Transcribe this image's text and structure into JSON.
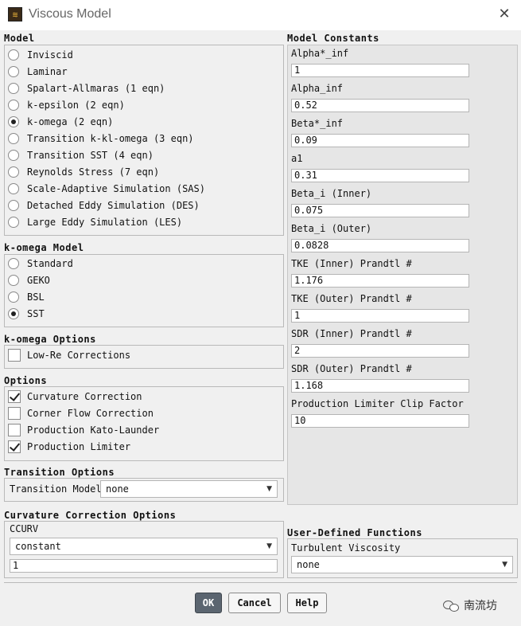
{
  "window": {
    "title": "Viscous Model"
  },
  "model": {
    "title": "Model",
    "options": [
      {
        "label": "Inviscid",
        "selected": false
      },
      {
        "label": "Laminar",
        "selected": false
      },
      {
        "label": "Spalart-Allmaras (1 eqn)",
        "selected": false
      },
      {
        "label": "k-epsilon (2 eqn)",
        "selected": false
      },
      {
        "label": "k-omega (2 eqn)",
        "selected": true
      },
      {
        "label": "Transition k-kl-omega (3 eqn)",
        "selected": false
      },
      {
        "label": "Transition SST (4 eqn)",
        "selected": false
      },
      {
        "label": "Reynolds Stress (7 eqn)",
        "selected": false
      },
      {
        "label": "Scale-Adaptive Simulation (SAS)",
        "selected": false
      },
      {
        "label": "Detached Eddy Simulation (DES)",
        "selected": false
      },
      {
        "label": "Large Eddy Simulation (LES)",
        "selected": false
      }
    ]
  },
  "komega_model": {
    "title": "k-omega Model",
    "options": [
      {
        "label": "Standard",
        "selected": false
      },
      {
        "label": "GEKO",
        "selected": false
      },
      {
        "label": "BSL",
        "selected": false
      },
      {
        "label": "SST",
        "selected": true
      }
    ]
  },
  "komega_options": {
    "title": "k-omega Options",
    "items": [
      {
        "label": "Low-Re Corrections",
        "checked": false
      }
    ]
  },
  "options": {
    "title": "Options",
    "items": [
      {
        "label": "Curvature Correction",
        "checked": true
      },
      {
        "label": "Corner Flow Correction",
        "checked": false
      },
      {
        "label": "Production Kato-Launder",
        "checked": false
      },
      {
        "label": "Production Limiter",
        "checked": true
      }
    ]
  },
  "transition_options": {
    "title": "Transition Options",
    "model_label": "Transition Model",
    "model_value": "none"
  },
  "curvature_options": {
    "title": "Curvature Correction Options",
    "ccurv_label": "CCURV",
    "ccurv_mode": "constant",
    "ccurv_value": "1"
  },
  "constants": {
    "title": "Model Constants",
    "items": [
      {
        "label": "Alpha*_inf",
        "value": "1"
      },
      {
        "label": "Alpha_inf",
        "value": "0.52"
      },
      {
        "label": "Beta*_inf",
        "value": "0.09"
      },
      {
        "label": "a1",
        "value": "0.31"
      },
      {
        "label": "Beta_i (Inner)",
        "value": "0.075"
      },
      {
        "label": "Beta_i (Outer)",
        "value": "0.0828"
      },
      {
        "label": "TKE (Inner) Prandtl #",
        "value": "1.176"
      },
      {
        "label": "TKE (Outer) Prandtl #",
        "value": "1"
      },
      {
        "label": "SDR (Inner) Prandtl #",
        "value": "2"
      },
      {
        "label": "SDR (Outer) Prandtl #",
        "value": "1.168"
      },
      {
        "label": "Production Limiter Clip Factor",
        "value": "10"
      }
    ]
  },
  "udf": {
    "title": "User-Defined Functions",
    "turbulent_viscosity_label": "Turbulent Viscosity",
    "turbulent_viscosity_value": "none"
  },
  "buttons": {
    "ok": "OK",
    "cancel": "Cancel",
    "help": "Help"
  },
  "watermark": {
    "text": "南流坊"
  },
  "icons": {
    "close": "close-icon",
    "app": "app-icon",
    "dropdown": "chevron-down-icon"
  }
}
